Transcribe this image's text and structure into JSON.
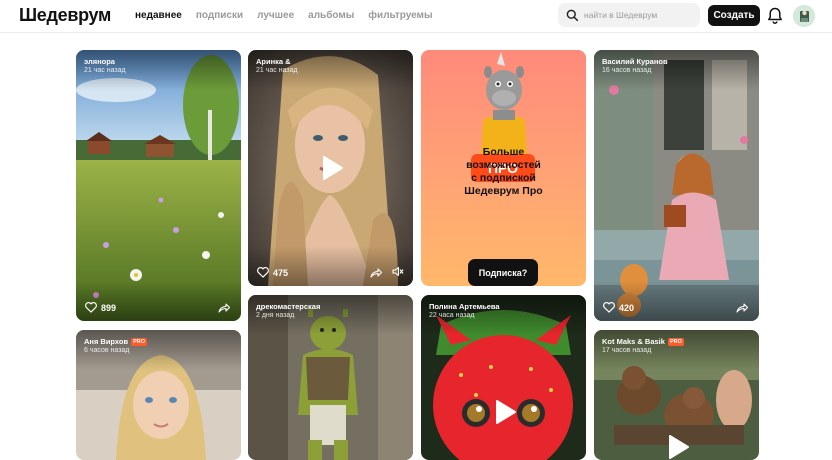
{
  "header": {
    "logo": "Шедеврум",
    "nav": [
      "недавнее",
      "подписки",
      "лучшее",
      "альбомы",
      "фильтруемы"
    ],
    "search_placeholder": "найти в Шедеврум",
    "create_label": "Создать"
  },
  "feed": {
    "cards": [
      {
        "author": "элянора",
        "time": "21 час назад",
        "likes": "899"
      },
      {
        "author": "Аринка &",
        "time": "21 час назад",
        "likes": "475"
      },
      {
        "author": "Василий Куранов",
        "time": "16 часов назад",
        "likes": "420"
      },
      {
        "author": "Аня Вирхов",
        "time": "6 часов назад",
        "pro": "PRO"
      },
      {
        "author": "дрекомастерская",
        "time": "2 дня назад"
      },
      {
        "author": "Полина Артемьева",
        "time": "22 часа назад"
      },
      {
        "author": "Kot Maks & Basik",
        "time": "17 часов назад",
        "pro": "PRO"
      }
    ],
    "promo": {
      "sign": "ПРО",
      "title_lines": [
        "Больше",
        "возможностей",
        "с подпиской",
        "Шедеврум Про"
      ],
      "button": "Подписка?"
    }
  },
  "colors": {
    "accent": "#ff4a1a",
    "promo_top": "#ff8a7a",
    "promo_bottom": "#ffb86a"
  }
}
